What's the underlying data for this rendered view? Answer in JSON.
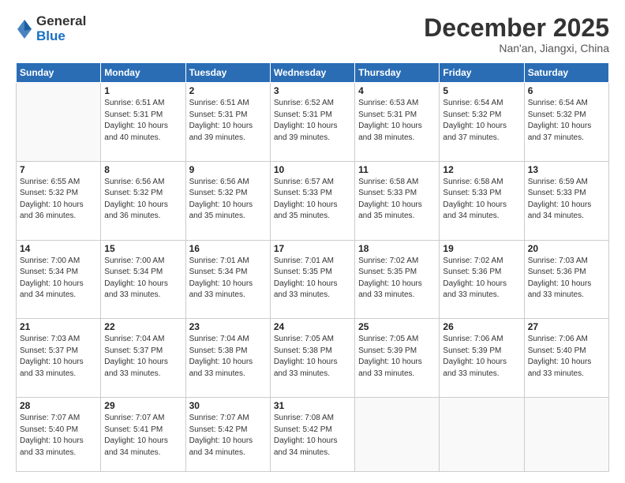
{
  "logo": {
    "general": "General",
    "blue": "Blue"
  },
  "title": "December 2025",
  "location": "Nan'an, Jiangxi, China",
  "weekdays": [
    "Sunday",
    "Monday",
    "Tuesday",
    "Wednesday",
    "Thursday",
    "Friday",
    "Saturday"
  ],
  "weeks": [
    [
      {
        "day": "",
        "info": ""
      },
      {
        "day": "1",
        "info": "Sunrise: 6:51 AM\nSunset: 5:31 PM\nDaylight: 10 hours\nand 40 minutes."
      },
      {
        "day": "2",
        "info": "Sunrise: 6:51 AM\nSunset: 5:31 PM\nDaylight: 10 hours\nand 39 minutes."
      },
      {
        "day": "3",
        "info": "Sunrise: 6:52 AM\nSunset: 5:31 PM\nDaylight: 10 hours\nand 39 minutes."
      },
      {
        "day": "4",
        "info": "Sunrise: 6:53 AM\nSunset: 5:31 PM\nDaylight: 10 hours\nand 38 minutes."
      },
      {
        "day": "5",
        "info": "Sunrise: 6:54 AM\nSunset: 5:32 PM\nDaylight: 10 hours\nand 37 minutes."
      },
      {
        "day": "6",
        "info": "Sunrise: 6:54 AM\nSunset: 5:32 PM\nDaylight: 10 hours\nand 37 minutes."
      }
    ],
    [
      {
        "day": "7",
        "info": "Sunrise: 6:55 AM\nSunset: 5:32 PM\nDaylight: 10 hours\nand 36 minutes."
      },
      {
        "day": "8",
        "info": "Sunrise: 6:56 AM\nSunset: 5:32 PM\nDaylight: 10 hours\nand 36 minutes."
      },
      {
        "day": "9",
        "info": "Sunrise: 6:56 AM\nSunset: 5:32 PM\nDaylight: 10 hours\nand 35 minutes."
      },
      {
        "day": "10",
        "info": "Sunrise: 6:57 AM\nSunset: 5:33 PM\nDaylight: 10 hours\nand 35 minutes."
      },
      {
        "day": "11",
        "info": "Sunrise: 6:58 AM\nSunset: 5:33 PM\nDaylight: 10 hours\nand 35 minutes."
      },
      {
        "day": "12",
        "info": "Sunrise: 6:58 AM\nSunset: 5:33 PM\nDaylight: 10 hours\nand 34 minutes."
      },
      {
        "day": "13",
        "info": "Sunrise: 6:59 AM\nSunset: 5:33 PM\nDaylight: 10 hours\nand 34 minutes."
      }
    ],
    [
      {
        "day": "14",
        "info": "Sunrise: 7:00 AM\nSunset: 5:34 PM\nDaylight: 10 hours\nand 34 minutes."
      },
      {
        "day": "15",
        "info": "Sunrise: 7:00 AM\nSunset: 5:34 PM\nDaylight: 10 hours\nand 33 minutes."
      },
      {
        "day": "16",
        "info": "Sunrise: 7:01 AM\nSunset: 5:34 PM\nDaylight: 10 hours\nand 33 minutes."
      },
      {
        "day": "17",
        "info": "Sunrise: 7:01 AM\nSunset: 5:35 PM\nDaylight: 10 hours\nand 33 minutes."
      },
      {
        "day": "18",
        "info": "Sunrise: 7:02 AM\nSunset: 5:35 PM\nDaylight: 10 hours\nand 33 minutes."
      },
      {
        "day": "19",
        "info": "Sunrise: 7:02 AM\nSunset: 5:36 PM\nDaylight: 10 hours\nand 33 minutes."
      },
      {
        "day": "20",
        "info": "Sunrise: 7:03 AM\nSunset: 5:36 PM\nDaylight: 10 hours\nand 33 minutes."
      }
    ],
    [
      {
        "day": "21",
        "info": "Sunrise: 7:03 AM\nSunset: 5:37 PM\nDaylight: 10 hours\nand 33 minutes."
      },
      {
        "day": "22",
        "info": "Sunrise: 7:04 AM\nSunset: 5:37 PM\nDaylight: 10 hours\nand 33 minutes."
      },
      {
        "day": "23",
        "info": "Sunrise: 7:04 AM\nSunset: 5:38 PM\nDaylight: 10 hours\nand 33 minutes."
      },
      {
        "day": "24",
        "info": "Sunrise: 7:05 AM\nSunset: 5:38 PM\nDaylight: 10 hours\nand 33 minutes."
      },
      {
        "day": "25",
        "info": "Sunrise: 7:05 AM\nSunset: 5:39 PM\nDaylight: 10 hours\nand 33 minutes."
      },
      {
        "day": "26",
        "info": "Sunrise: 7:06 AM\nSunset: 5:39 PM\nDaylight: 10 hours\nand 33 minutes."
      },
      {
        "day": "27",
        "info": "Sunrise: 7:06 AM\nSunset: 5:40 PM\nDaylight: 10 hours\nand 33 minutes."
      }
    ],
    [
      {
        "day": "28",
        "info": "Sunrise: 7:07 AM\nSunset: 5:40 PM\nDaylight: 10 hours\nand 33 minutes."
      },
      {
        "day": "29",
        "info": "Sunrise: 7:07 AM\nSunset: 5:41 PM\nDaylight: 10 hours\nand 34 minutes."
      },
      {
        "day": "30",
        "info": "Sunrise: 7:07 AM\nSunset: 5:42 PM\nDaylight: 10 hours\nand 34 minutes."
      },
      {
        "day": "31",
        "info": "Sunrise: 7:08 AM\nSunset: 5:42 PM\nDaylight: 10 hours\nand 34 minutes."
      },
      {
        "day": "",
        "info": ""
      },
      {
        "day": "",
        "info": ""
      },
      {
        "day": "",
        "info": ""
      }
    ]
  ]
}
